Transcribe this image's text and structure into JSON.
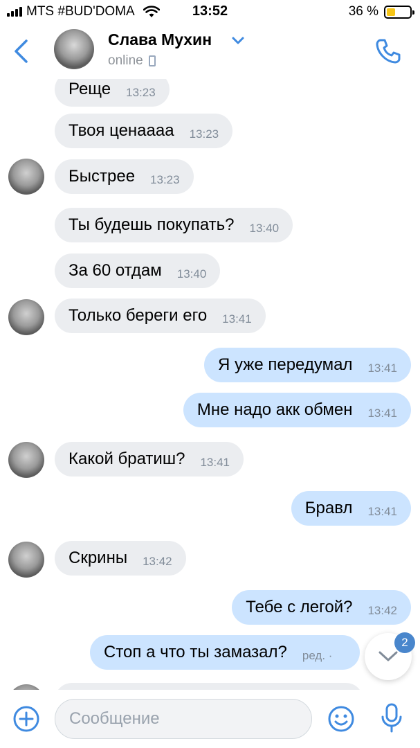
{
  "status_bar": {
    "carrier": "MTS #BUD'DOMA",
    "time": "13:52",
    "battery": "36 %",
    "battery_level": 0.36
  },
  "header": {
    "name": "Слава Мухин",
    "status": "online"
  },
  "messages": [
    {
      "dir": "in",
      "text": "Реще",
      "time": "13:23"
    },
    {
      "dir": "in",
      "text": "Твоя ценаааа",
      "time": "13:23"
    },
    {
      "dir": "in",
      "text": "Быстрее",
      "time": "13:23"
    },
    {
      "dir": "in",
      "text": "Ты будешь покупать?",
      "time": "13:40"
    },
    {
      "dir": "in",
      "text": "За 60 отдам",
      "time": "13:40"
    },
    {
      "dir": "in",
      "text": "Только береги его",
      "time": "13:41"
    },
    {
      "dir": "out",
      "text": "Я уже передумал",
      "time": "13:41"
    },
    {
      "dir": "out",
      "text": "Мне надо акк обмен",
      "time": "13:41"
    },
    {
      "dir": "in",
      "text": "Какой братиш?",
      "time": "13:41"
    },
    {
      "dir": "out",
      "text": "Бравл",
      "time": "13:41"
    },
    {
      "dir": "in",
      "text": "Скрины",
      "time": "13:42"
    },
    {
      "dir": "out",
      "text": "Тебе с легой?",
      "time": "13:42"
    },
    {
      "dir": "out",
      "text": "Стоп а что ты замазал?",
      "time": "ред. ·"
    }
  ],
  "scroll_badge": "2",
  "composer": {
    "placeholder": "Сообщение"
  },
  "icons": [
    "back-icon",
    "chevron-down-icon",
    "phone-call-icon",
    "mobile-device-icon",
    "add-icon",
    "emoji-icon",
    "microphone-icon",
    "arrow-down-icon"
  ],
  "colors": {
    "accent": "#4986cc",
    "incoming_bubble": "#ebedf0",
    "outgoing_bubble": "#cce4ff",
    "battery_fill": "#f6c517"
  }
}
